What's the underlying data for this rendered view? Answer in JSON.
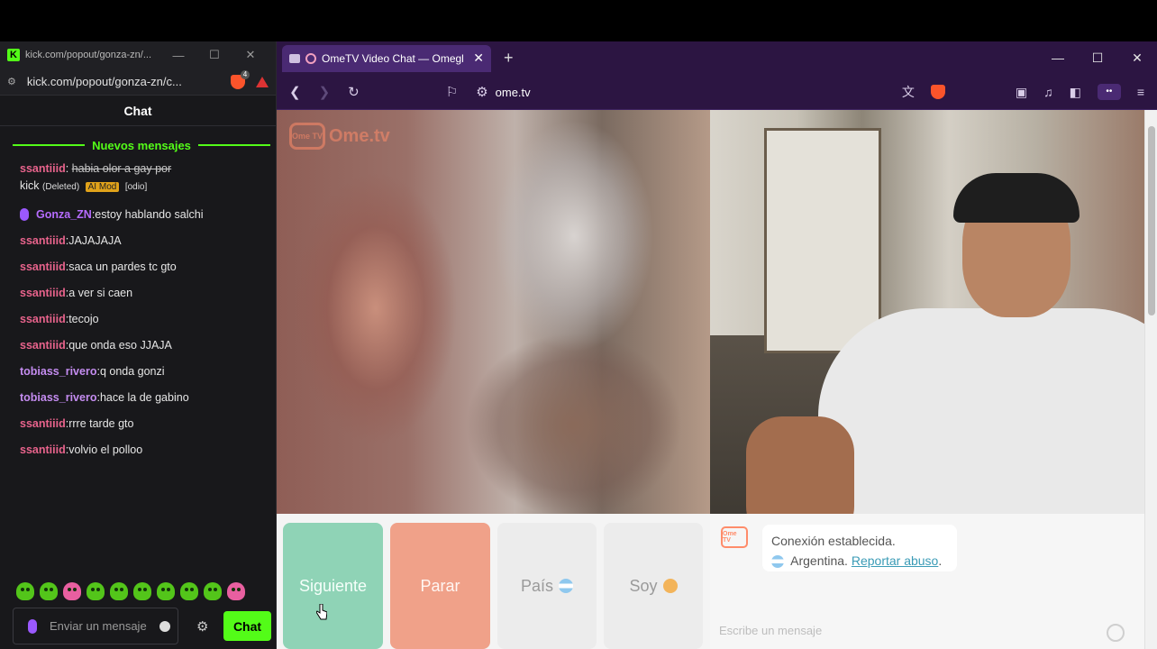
{
  "kick_window": {
    "title": "kick.com/popout/gonza-zn/...",
    "url": "kick.com/popout/gonza-zn/c...",
    "chat_title": "Chat",
    "new_messages_label": "Nuevos mensajes",
    "deleted_message": {
      "user": "ssantiiid",
      "text_line1": "habia olor a gay por",
      "text_line2": "kick",
      "deleted_tag": "(Deleted)",
      "aimod_tag": "AI Mod",
      "reason_tag": "[odio]"
    },
    "messages": [
      {
        "user": "Gonza_ZN",
        "text": "estoy hablando salchi",
        "color": "#b66cff",
        "badge": "mic"
      },
      {
        "user": "ssantiiid",
        "text": "JAJAJAJA",
        "color": "#e8638c"
      },
      {
        "user": "ssantiiid",
        "text": "saca un pardes tc gto",
        "color": "#e8638c"
      },
      {
        "user": "ssantiiid",
        "text": "a ver si caen",
        "color": "#e8638c"
      },
      {
        "user": "ssantiiid",
        "text": "tecojo",
        "color": "#e8638c"
      },
      {
        "user": "ssantiiid",
        "text": "que onda eso JJAJA",
        "color": "#e8638c"
      },
      {
        "user": "tobiass_rivero",
        "text": "q onda gonzi",
        "color": "#c48cf0"
      },
      {
        "user": "tobiass_rivero",
        "text": "hace la de gabino",
        "color": "#c48cf0"
      },
      {
        "user": "ssantiiid",
        "text": "rrre tarde gto",
        "color": "#e8638c"
      },
      {
        "user": "ssantiiid",
        "text": "volvio el polloo",
        "color": "#e8638c"
      }
    ],
    "input_placeholder": "Enviar un mensaje",
    "send_label": "Chat",
    "accent": "#53fc18"
  },
  "browser": {
    "tab_title": "OmeTV Video Chat — Omegl",
    "address": "ome.tv",
    "accent": "#2c1542"
  },
  "ometv": {
    "logo_text": "Ome.tv",
    "logo_badge": "Ome TV",
    "buttons": {
      "next": "Siguiente",
      "stop": "Parar",
      "country": "País",
      "gender": "Soy"
    },
    "chat": {
      "status": "Conexión establecida.",
      "country": "Argentina.",
      "report_link": "Reportar abuso",
      "report_suffix": ".",
      "input_placeholder": "Escribe un mensaje"
    }
  }
}
